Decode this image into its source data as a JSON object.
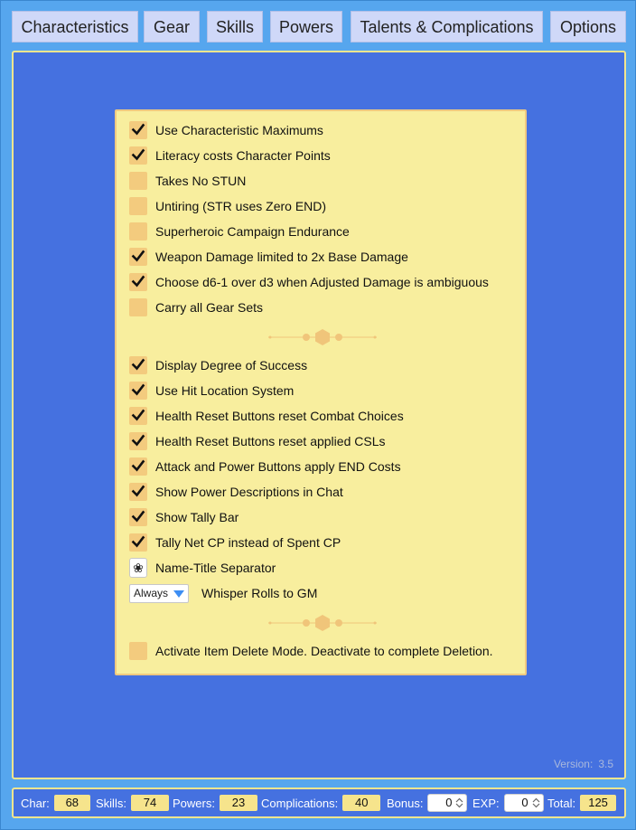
{
  "tabs": [
    "Characteristics",
    "Gear",
    "Skills",
    "Powers",
    "Talents & Complications",
    "Options"
  ],
  "options_group1": [
    {
      "label": "Use Characteristic Maximums",
      "checked": true
    },
    {
      "label": "Literacy costs Character Points",
      "checked": true
    },
    {
      "label": "Takes No STUN",
      "checked": false
    },
    {
      "label": "Untiring (STR uses Zero END)",
      "checked": false
    },
    {
      "label": "Superheroic Campaign Endurance",
      "checked": false
    },
    {
      "label": "Weapon Damage limited to 2x Base Damage",
      "checked": true
    },
    {
      "label": "Choose d6-1 over d3 when Adjusted Damage is ambiguous",
      "checked": true
    },
    {
      "label": "Carry all Gear Sets",
      "checked": false
    }
  ],
  "options_group2": [
    {
      "label": "Display Degree of Success",
      "checked": true
    },
    {
      "label": "Use Hit Location System",
      "checked": true
    },
    {
      "label": "Health Reset Buttons reset Combat Choices",
      "checked": true
    },
    {
      "label": "Health Reset Buttons reset applied CSLs",
      "checked": true
    },
    {
      "label": "Attack and Power Buttons apply END Costs",
      "checked": true
    },
    {
      "label": "Show Power Descriptions in Chat",
      "checked": true
    },
    {
      "label": "Show Tally Bar",
      "checked": true
    },
    {
      "label": "Tally Net CP instead of Spent CP",
      "checked": true
    }
  ],
  "separator": {
    "symbol": "❀",
    "label": "Name-Title Separator"
  },
  "whisper": {
    "value": "Always",
    "label": "Whisper Rolls to GM"
  },
  "delete_mode": {
    "label": "Activate Item Delete Mode. Deactivate to complete Deletion.",
    "checked": false
  },
  "version": {
    "label": "Version:",
    "value": "3.5"
  },
  "tally": {
    "char": {
      "label": "Char:",
      "value": "68"
    },
    "skills": {
      "label": "Skills:",
      "value": "74"
    },
    "powers": {
      "label": "Powers:",
      "value": "23"
    },
    "complications": {
      "label": "Complications:",
      "value": "40"
    },
    "bonus": {
      "label": "Bonus:",
      "value": "0"
    },
    "exp": {
      "label": "EXP:",
      "value": "0"
    },
    "total": {
      "label": "Total:",
      "value": "125"
    }
  },
  "colors": {
    "background": "#5aa9f0",
    "main_panel": "#4571e0",
    "options_panel": "#f8ee9e",
    "checkbox": "#f3cb7e",
    "tab": "#cfd8f8"
  },
  "icons": {
    "checkmark": "checkmark-icon",
    "divider": "hexagon-divider-icon",
    "dropdown": "triangle-down-icon"
  }
}
